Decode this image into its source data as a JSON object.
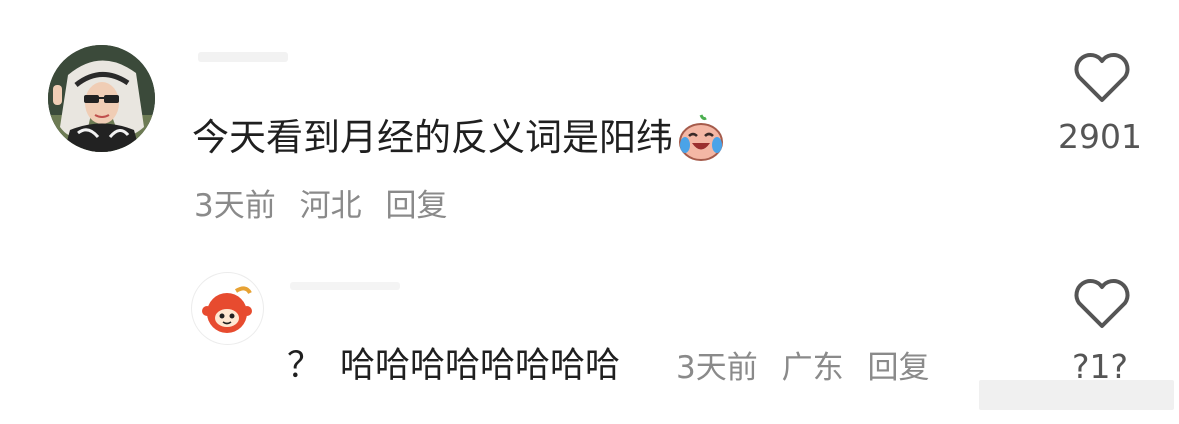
{
  "comment": {
    "text": "今天看到月经的反义词是阳纬",
    "emoji_icon": "laughing-crying-face-icon",
    "meta": {
      "time": "3天前",
      "location": "河北",
      "reply_label": "回复"
    },
    "likes": "2901"
  },
  "reply": {
    "prefix": "？",
    "text": "哈哈哈哈哈哈哈哈",
    "meta": {
      "time": "3天前",
      "location": "广东",
      "reply_label": "回复"
    },
    "likes": "?1?"
  },
  "icons": {
    "like": "heart-outline-icon",
    "reply_avatar": "cartoon-apple-avatar-icon"
  },
  "colors": {
    "text": "#1f1f1f",
    "meta": "#8a8a8a",
    "heart_stroke": "#555555"
  }
}
